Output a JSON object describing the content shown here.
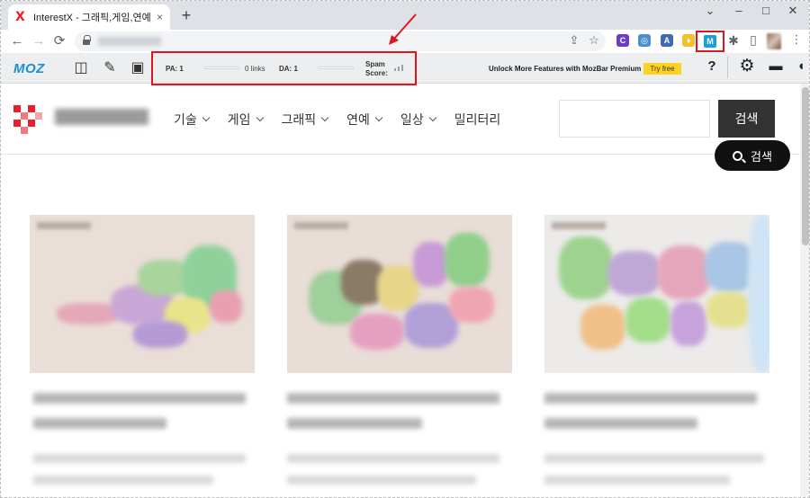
{
  "browser": {
    "tab_title": "InterestX - 그래픽,게임,연예,IT",
    "tab_close": "×",
    "new_tab": "+",
    "minimize": "–",
    "maximize": "□",
    "close": "✕",
    "back": "←",
    "forward": "→",
    "reload": "⟳",
    "share_icon": "⇪",
    "star_icon": "☆",
    "puzzle_icon": "✱",
    "sidepanel_icon": "▯",
    "menu_icon": "⋮",
    "extensions": [
      {
        "label": "C",
        "color": "#6b3cc9"
      },
      {
        "label": "◎",
        "color": "#4a8fd6"
      },
      {
        "label": "A",
        "color": "#3e6bb5"
      },
      {
        "label": "♦",
        "color": "#f2c12e"
      }
    ],
    "mozbar_ext_label": "M"
  },
  "mozbar": {
    "logo": "MOZ",
    "pa_label": "PA: 1",
    "links_label": "0 links",
    "da_label": "DA: 1",
    "spam_label_1": "Spam",
    "spam_label_2": "Score:",
    "promo_text": "Unlock More Features with MozBar Premium",
    "try_free": "Try free",
    "help_icon": "?",
    "settings_icon": "⚙",
    "collapse_icon": "▬",
    "more_icon": "◖",
    "tool_icons": [
      "◫",
      "✎",
      "▣"
    ]
  },
  "site": {
    "nav": [
      "기술",
      "게임",
      "그래픽",
      "연예",
      "일상",
      "밀리터리"
    ],
    "nav_has_dropdown": [
      true,
      true,
      true,
      true,
      true,
      false
    ],
    "search_button": "검색",
    "floating_search": "검색"
  },
  "cards": [
    {
      "thumb_bg": "#eaded8"
    },
    {
      "thumb_bg": "#e9ddd7"
    },
    {
      "thumb_bg": "#ecebea"
    }
  ],
  "colors": {
    "moz_blue": "#1e8fd0",
    "highlight_red": "#e0141e",
    "try_free_yellow": "#ffd21f"
  }
}
